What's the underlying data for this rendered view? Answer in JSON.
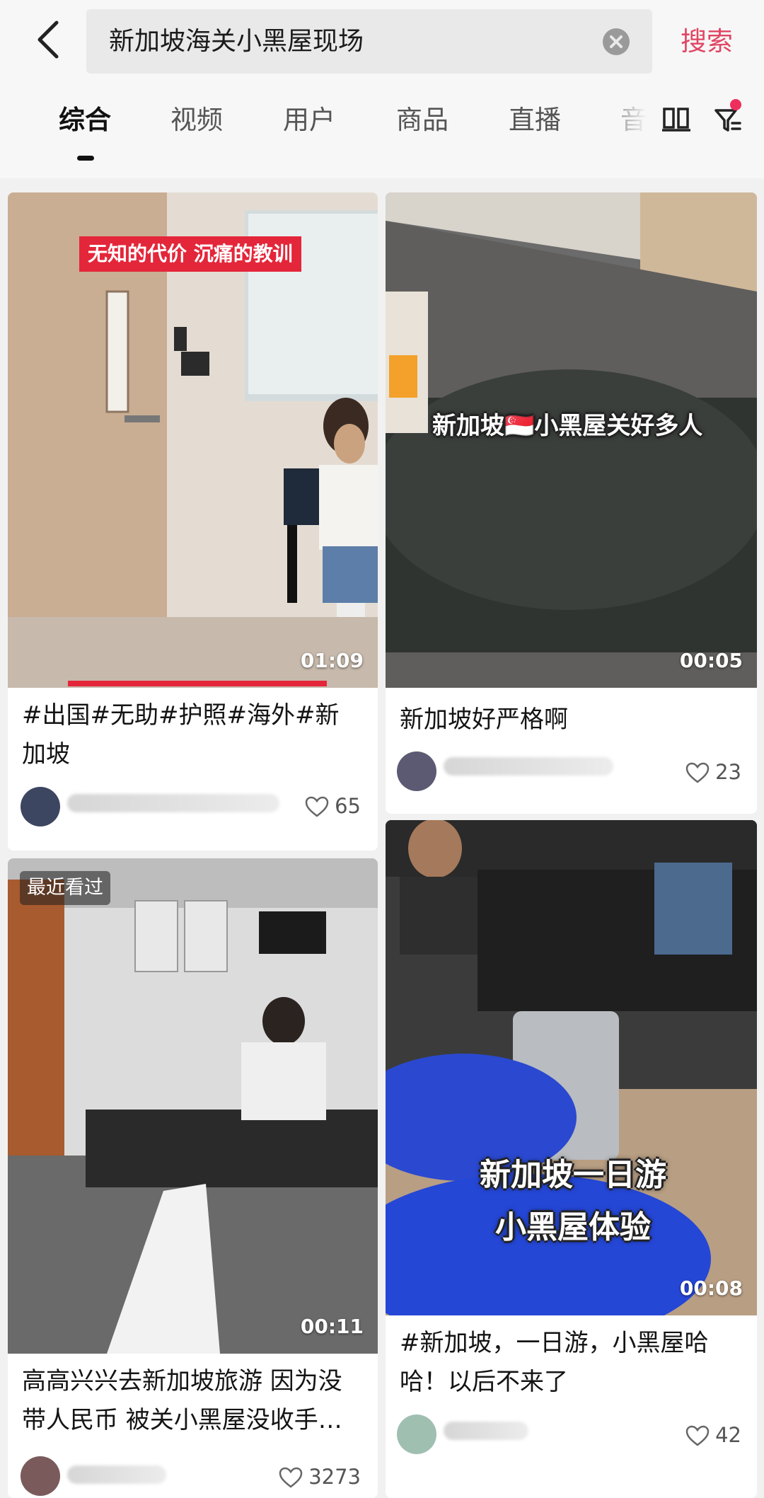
{
  "search": {
    "query": "新加坡海关小黑屋现场",
    "button_label": "搜索"
  },
  "tabs": [
    {
      "label": "综合",
      "active": true
    },
    {
      "label": "视频",
      "active": false
    },
    {
      "label": "用户",
      "active": false
    },
    {
      "label": "商品",
      "active": false
    },
    {
      "label": "直播",
      "active": false
    },
    {
      "label": "音",
      "active": false
    }
  ],
  "colors": {
    "accent": "#e04563",
    "notify_dot": "#ee2f5d",
    "overlay_red": "#e4263a"
  },
  "icons": [
    "back-arrow-icon",
    "clear-icon",
    "grid-view-icon",
    "filter-icon",
    "heart-icon"
  ],
  "cards": [
    {
      "overlay_text": "无知的代价 沉痛的教训",
      "duration": "01:09",
      "title": "#出国#无助#护照#海外#新加坡",
      "likes": "65",
      "watch_progress": 0.7
    },
    {
      "overlay_text": "新加坡🇸🇬小黑屋关好多人",
      "duration": "00:05",
      "title": "新加坡好严格啊",
      "likes": "23"
    },
    {
      "badge": "最近看过",
      "duration": "00:11",
      "title": "高高兴兴去新加坡旅游 因为没带人民币 被关小黑屋没收手…",
      "likes": "3273"
    },
    {
      "overlay_line1": "新加坡一日游",
      "overlay_line2": "小黑屋体验",
      "duration": "00:08",
      "title": "#新加坡，一日游，小黑屋哈哈！以后不来了",
      "likes": "42"
    }
  ]
}
